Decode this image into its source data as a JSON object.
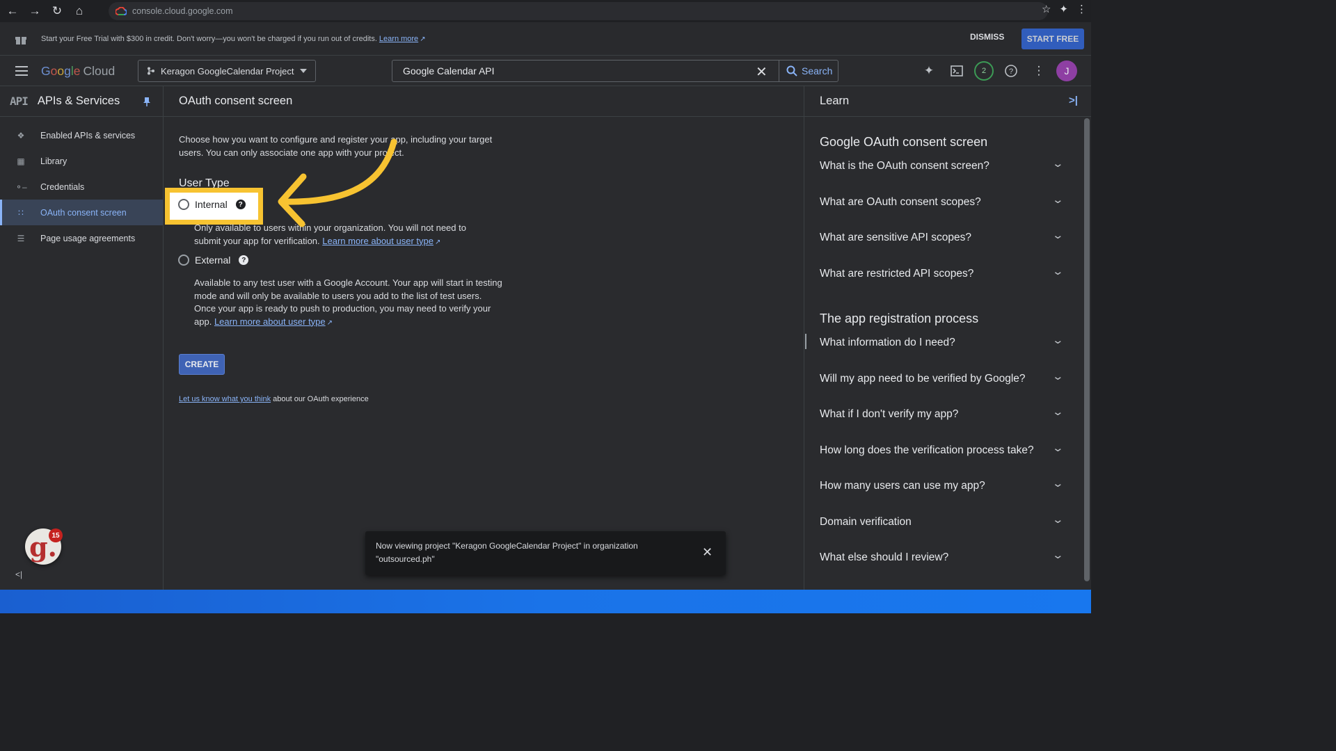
{
  "browser": {
    "url": "console.cloud.google.com"
  },
  "trial_bar": {
    "text": "Start your Free Trial with $300 in credit. Don't worry—you won't be charged if you run out of credits.",
    "learn_more": "Learn more",
    "dismiss": "DISMISS",
    "start_free": "START FREE"
  },
  "topbar": {
    "logo_google": [
      "G",
      "o",
      "o",
      "g",
      "l",
      "e"
    ],
    "logo_cloud": "Cloud",
    "project": "Keragon GoogleCalendar Project",
    "search_value": "Google Calendar API",
    "search_button": "Search",
    "notifications_count": "2",
    "avatar_initial": "J"
  },
  "sidebar": {
    "api_mark": "API",
    "title": "APIs & Services",
    "items": [
      {
        "label": "Enabled APIs & services",
        "icon": "api-diamond-icon"
      },
      {
        "label": "Library",
        "icon": "library-grid-icon"
      },
      {
        "label": "Credentials",
        "icon": "key-icon"
      },
      {
        "label": "OAuth consent screen",
        "icon": "consent-dots-icon",
        "active": true
      },
      {
        "label": "Page usage agreements",
        "icon": "settings-list-icon"
      }
    ],
    "extension_count": "15"
  },
  "main": {
    "title": "OAuth consent screen",
    "intro": "Choose how you want to configure and register your app, including your target users. You can only associate one app with your project.",
    "user_type_heading": "User Type",
    "internal": {
      "label": "Internal",
      "description": "Only available to users within your organization. You will not need to submit your app for verification.",
      "link": "Learn more about user type"
    },
    "external": {
      "label": "External",
      "description": "Available to any test user with a Google Account. Your app will start in testing mode and will only be available to users you add to the list of test users. Once your app is ready to push to production, you may need to verify your app.",
      "link": "Learn more about user type"
    },
    "create_button": "CREATE",
    "feedback_link": "Let us know what you think",
    "feedback_text": "about our OAuth experience"
  },
  "toast": {
    "text": "Now viewing project \"Keragon GoogleCalendar Project\" in organization \"outsourced.ph\""
  },
  "learn": {
    "title": "Learn",
    "section1": "Google OAuth consent screen",
    "faq1": [
      "What is the OAuth consent screen?",
      "What are OAuth consent scopes?",
      "What are sensitive API scopes?",
      "What are restricted API scopes?"
    ],
    "section2": "The app registration process",
    "faq2": [
      "What information do I need?",
      "Will my app need to be verified by Google?",
      "What if I don't verify my app?",
      "How long does the verification process take?",
      "How many users can use my app?",
      "Domain verification",
      "What else should I review?"
    ]
  },
  "colors": {
    "highlight": "#f7c331",
    "accent": "#8ab4f8",
    "primary_button": "#3367d6"
  }
}
